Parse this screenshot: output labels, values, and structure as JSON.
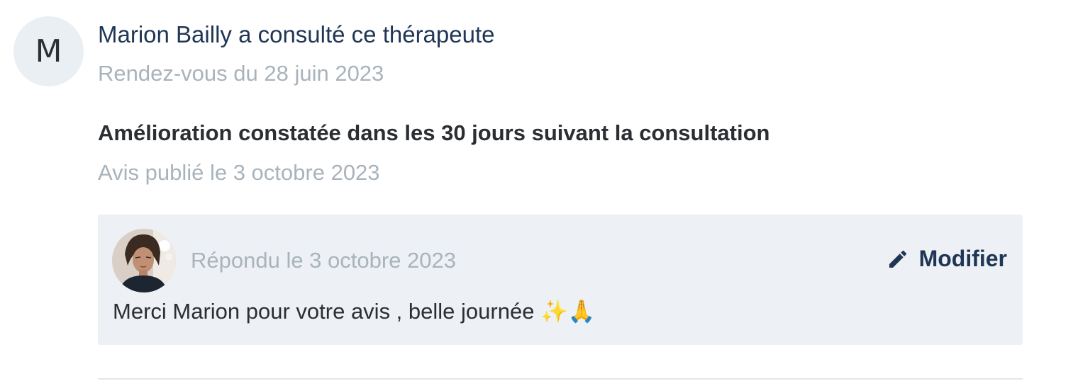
{
  "review": {
    "avatar_initial": "M",
    "reviewer_line": "Marion Bailly a consulté ce thérapeute",
    "appointment_date": "Rendez-vous du 28 juin 2023",
    "title": "Amélioration constatée dans les 30 jours suivant la consultation",
    "published_date": "Avis publié le 3 octobre 2023"
  },
  "reply": {
    "date": "Répondu le 3 octobre 2023",
    "edit_label": "Modifier",
    "edit_icon": "pencil-icon",
    "text": "Merci Marion pour votre avis , belle journée ✨🙏"
  },
  "colors": {
    "primary_text": "#1f3654",
    "muted_text": "#a9b3bc",
    "reply_background": "#edf0f4",
    "avatar_background": "#eaeff3"
  }
}
